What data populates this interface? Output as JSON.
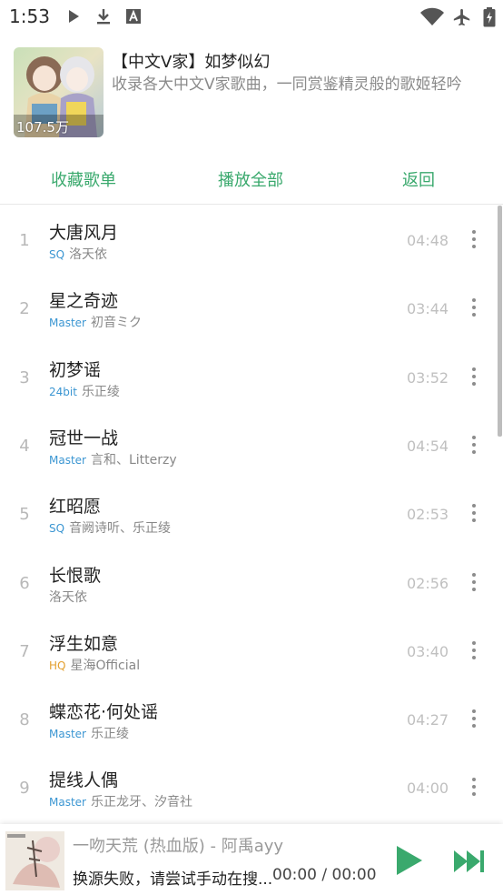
{
  "status_bar": {
    "time": "1:53",
    "left_icons": [
      "play-icon",
      "download-icon",
      "font-icon"
    ],
    "right_icons": [
      "wifi-icon",
      "airplane-icon",
      "battery-icon"
    ]
  },
  "playlist": {
    "title": "【中文V家】如梦似幻",
    "description": "收录各大中文V家歌曲，一同赏鉴精灵般的歌姬轻吟",
    "play_count": "107.5万"
  },
  "actions": {
    "collect_label": "收藏歌单",
    "play_all_label": "播放全部",
    "back_label": "返回"
  },
  "colors": {
    "accent": "#3aa96d",
    "quality_blue": "#3b96d2",
    "quality_orange": "#e3a030"
  },
  "songs": [
    {
      "index": "1",
      "title": "大唐风月",
      "quality": "SQ",
      "artist": "洛天依",
      "duration": "04:48"
    },
    {
      "index": "2",
      "title": "星之奇迹",
      "quality": "Master",
      "artist": "初音ミク",
      "duration": "03:44"
    },
    {
      "index": "3",
      "title": "初梦谣",
      "quality": "24bit",
      "artist": "乐正绫",
      "duration": "03:52"
    },
    {
      "index": "4",
      "title": "冠世一战",
      "quality": "Master",
      "artist": "言和、Litterzy",
      "duration": "04:54"
    },
    {
      "index": "5",
      "title": "红昭愿",
      "quality": "SQ",
      "artist": "音阙诗听、乐正绫",
      "duration": "02:53"
    },
    {
      "index": "6",
      "title": "长恨歌",
      "quality": "",
      "artist": "洛天依",
      "duration": "02:56"
    },
    {
      "index": "7",
      "title": "浮生如意",
      "quality": "HQ",
      "artist": "星海Official",
      "duration": "03:40"
    },
    {
      "index": "8",
      "title": "蝶恋花·何处谣",
      "quality": "Master",
      "artist": "乐正绫",
      "duration": "04:27"
    },
    {
      "index": "9",
      "title": "提线人偶",
      "quality": "Master",
      "artist": "乐正龙牙、汐音社",
      "duration": "04:00"
    }
  ],
  "player": {
    "title": "一吻天荒 (热血版) - 阿禹ayy",
    "status": "换源失败，请尝试手动在搜...",
    "time": "00:00 / 00:00"
  }
}
